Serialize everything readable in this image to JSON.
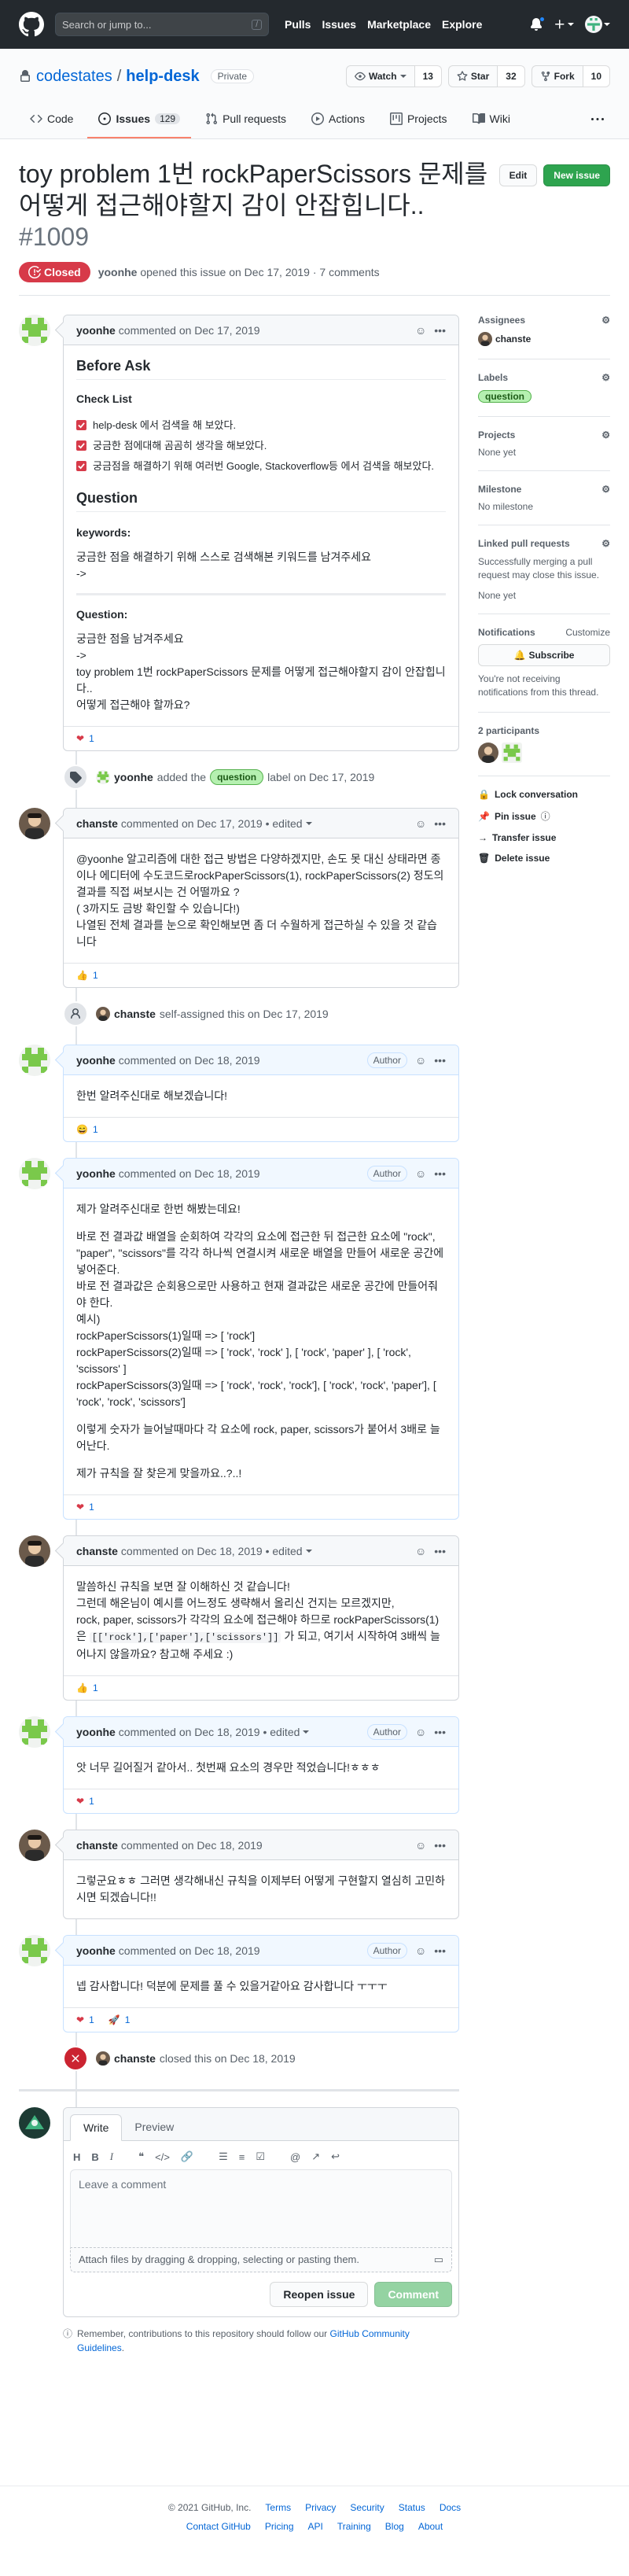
{
  "header": {
    "search_placeholder": "Search or jump to...",
    "slash_key": "/",
    "nav": [
      "Pulls",
      "Issues",
      "Marketplace",
      "Explore"
    ]
  },
  "repo": {
    "owner": "codestates",
    "separator": "/",
    "name": "help-desk",
    "visibility": "Private",
    "watch_label": "Watch",
    "watch_count": "13",
    "star_label": "Star",
    "star_count": "32",
    "fork_label": "Fork",
    "fork_count": "10",
    "tabs": {
      "code": "Code",
      "issues": "Issues",
      "issues_count": "129",
      "pulls": "Pull requests",
      "actions": "Actions",
      "projects": "Projects",
      "wiki": "Wiki"
    }
  },
  "issue": {
    "title": "toy problem 1번 rockPaperScissors 문제를 어떻게 접근해야할지 감이 안잡힙니다.. ",
    "number": "#1009",
    "edit_label": "Edit",
    "new_issue_label": "New issue",
    "state": "Closed",
    "author": "yoonhe",
    "opened_text": "opened this issue on Dec 17, 2019 · 7 comments"
  },
  "comments": {
    "c1": {
      "author": "yoonhe",
      "meta": "commented on Dec 17, 2019",
      "h2_before": "Before Ask",
      "h3_checklist": "Check List",
      "checks": [
        "help-desk 에서 검색을 해 보았다.",
        "궁금한 점에대해 곰곰히 생각을 해보았다.",
        "궁금점을 해결하기 위해 여러번 Google, Stackoverflow등 에서 검색을 해보았다."
      ],
      "h2_question": "Question",
      "keywords_label": "keywords:",
      "keywords_text": "궁금한 점을 해결하기 위해 스스로 검색해본 키워드를 남겨주세요",
      "keywords_arrow": "->",
      "question_label": "Question:",
      "question_text": "궁금한 점을 남겨주세요",
      "question_arrow": "->",
      "question_line1": "toy problem 1번 rockPaperScissors 문제를 어떻게 접근해야할지 감이 안잡힙니다..",
      "question_line2": "어떻게 접근해야 할까요?",
      "reaction_count": "1"
    },
    "label_event": {
      "actor": "yoonhe",
      "text_before": "added the",
      "label": "question",
      "text_after": "label on Dec 17, 2019"
    },
    "c2": {
      "author": "chanste",
      "meta": "commented on Dec 17, 2019 • edited",
      "p1": "@yoonhe 알고리즘에 대한 접근 방법은 다양하겠지만, 손도 못 대신 상태라면 종이나 에디터에 수도코드로rockPaperScissors(1), rockPaperScissors(2) 정도의 결과를 직접 써보시는 건 어떨까요 ?",
      "p2": "( 3까지도 금방 확인할 수 있습니다!)",
      "p3": "나열된 전체 결과를 눈으로 확인해보면 좀 더 수월하게 접근하실 수 있을 것 같습니다",
      "reaction_count": "1"
    },
    "assign_event": {
      "actor": "chanste",
      "text": "self-assigned this on Dec 17, 2019"
    },
    "c3": {
      "author": "yoonhe",
      "meta": "commented on Dec 18, 2019",
      "badge": "Author",
      "body": "한번 알려주신대로 해보겠습니다!",
      "reaction_count": "1"
    },
    "c4": {
      "author": "yoonhe",
      "meta": "commented on Dec 18, 2019",
      "badge": "Author",
      "p1": "제가 알려주신대로 한번 해봤는데요!",
      "p2": "바로 전 결과값 배열을 순회하여 각각의 요소에 접근한 뒤 접근한 요소에 \"rock\", \"paper\", \"scissors\"를 각각 하나씩 연결시켜 새로운 배열을 만들어 새로운 공간에 넣어준다.",
      "p3": "바로 전 결과값은 순회용으로만 사용하고 현재 결과값은 새로운 공간에 만들어줘야 한다.",
      "p4": "예시)",
      "p5": "rockPaperScissors(1)일때 => [ 'rock']",
      "p6": "rockPaperScissors(2)일때 => [ 'rock', 'rock' ], [ 'rock', 'paper' ], [ 'rock', 'scissors' ]",
      "p7": "rockPaperScissors(3)일때 => [ 'rock', 'rock', 'rock'], [ 'rock', 'rock', 'paper'], [ 'rock', 'rock', 'scissors']",
      "p8": "이렇게 숫자가 늘어날때마다 각 요소에 rock, paper, scissors가 붙어서 3배로 늘어난다.",
      "p9": "제가 규칙을 잘 찾은게 맞을까요..?..!",
      "reaction_count": "1"
    },
    "c5": {
      "author": "chanste",
      "meta": "commented on Dec 18, 2019 • edited",
      "p1": "말씀하신 규칙을 보면 잘 이해하신 것 같습니다!",
      "p2": "그런데 해온님이 예시를 어느정도 생략해서 올리신 건지는 모르겠지만,",
      "p3a": "rock, paper, scissors가 각각의 요소에 접근해야 하므로 rockPaperScissors(1)은",
      "code1": "[['rock'],['paper'],['scissors']]",
      "p3b": "가 되고, 여기서 시작하여 3배씩 늘어나지 않을까요? 참고해 주세요 :)",
      "reaction_count": "1"
    },
    "c6": {
      "author": "yoonhe",
      "meta": "commented on Dec 18, 2019 • edited",
      "badge": "Author",
      "body": "앗 너무 길어질거 같아서.. 첫번째 요소의 경우만 적었습니다!ㅎㅎㅎ",
      "reaction_count": "1"
    },
    "c7": {
      "author": "chanste",
      "meta": "commented on Dec 18, 2019",
      "body": "그렇군요ㅎㅎ 그러면 생각해내신 규칙을 이제부터 어떻게 구현할지 열심히 고민하시면 되겠습니다!!",
      "reaction_count": ""
    },
    "c8": {
      "author": "yoonhe",
      "meta": "commented on Dec 18, 2019",
      "badge": "Author",
      "body": "넵 감사합니다! 덕분에 문제를 풀 수 있을거같아요 감사합니다 ㅜㅜㅜ",
      "reaction_count_heart": "1",
      "reaction_count_rocket": "1"
    },
    "close_event": {
      "actor": "chanste",
      "text": "closed this on Dec 18, 2019"
    }
  },
  "new_comment": {
    "tab_write": "Write",
    "tab_preview": "Preview",
    "placeholder": "Leave a comment",
    "attach_text": "Attach files by dragging & dropping, selecting or pasting them.",
    "reopen_label": "Reopen issue",
    "comment_label": "Comment",
    "protip_before": "Remember, contributions to this repository should follow our",
    "protip_link": "GitHub Community Guidelines",
    "protip_after": "."
  },
  "sidebar": {
    "assignees_title": "Assignees",
    "assignee": "chanste",
    "labels_title": "Labels",
    "label": "question",
    "projects_title": "Projects",
    "projects_value": "None yet",
    "milestone_title": "Milestone",
    "milestone_value": "No milestone",
    "linked_title": "Linked pull requests",
    "linked_text": "Successfully merging a pull request may close this issue.",
    "linked_value": "None yet",
    "notif_title": "Notifications",
    "notif_customize": "Customize",
    "subscribe_label": "Subscribe",
    "notif_text": "You're not receiving notifications from this thread.",
    "participants_title": "2 participants",
    "lock_label": "Lock conversation",
    "pin_label": "Pin issue",
    "transfer_label": "Transfer issue",
    "delete_label": "Delete issue"
  },
  "footer": {
    "copyright": "© 2021 GitHub, Inc.",
    "row1": [
      "Terms",
      "Privacy",
      "Security",
      "Status",
      "Docs"
    ],
    "row2": [
      "Contact GitHub",
      "Pricing",
      "API",
      "Training",
      "Blog",
      "About"
    ]
  },
  "colors": {
    "closed_red": "#d73a49",
    "primary_green": "#2ea44f",
    "link_blue": "#0366d6",
    "header_dark": "#24292e"
  }
}
